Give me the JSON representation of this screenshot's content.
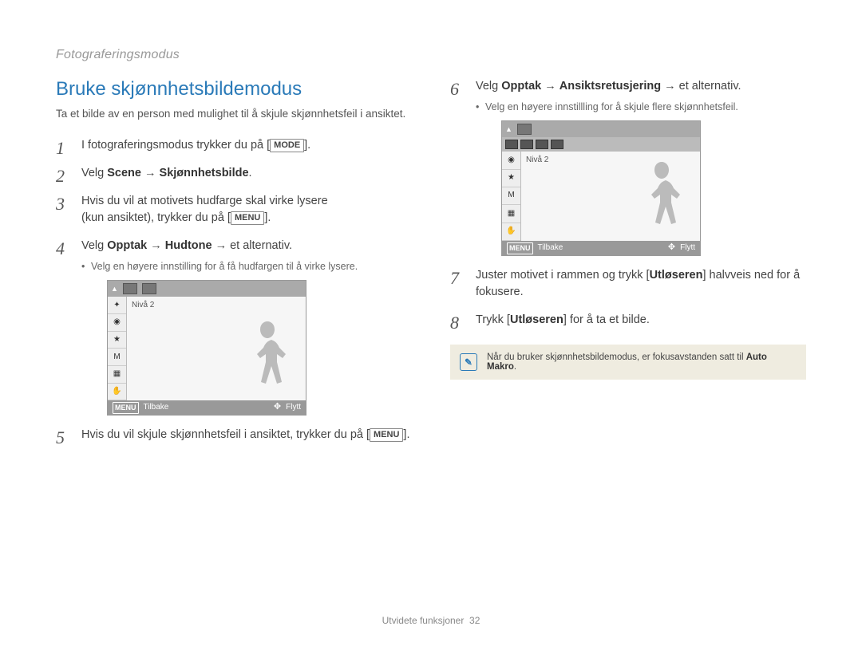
{
  "breadcrumb": "Fotograferingsmodus",
  "section_title": "Bruke skjønnhetsbildemodus",
  "intro": "Ta et bilde av en person med mulighet til å skjule skjønnhetsfeil i ansiktet.",
  "keys": {
    "mode": "MODE",
    "menu": "MENU"
  },
  "steps": {
    "s1": {
      "prefix": "I fotograferingsmodus trykker du på [",
      "suffix": "]."
    },
    "s2": {
      "prefix": "Velg ",
      "b1": "Scene",
      "arrow": " → ",
      "b2": "Skjønnhetsbilde",
      "suffix": "."
    },
    "s3": {
      "line1": "Hvis du vil at motivets hudfarge skal virke lysere",
      "line2_pre": "(kun ansiktet), trykker du på [",
      "line2_post": "]."
    },
    "s4": {
      "prefix": "Velg ",
      "b1": "Opptak",
      "arrow1": " → ",
      "b2": "Hudtone",
      "arrow2": " → et alternativ.",
      "sub": "Velg en høyere innstilling for å få hudfargen til å virke lysere."
    },
    "s5": {
      "pre": "Hvis du vil skjule skjønnhetsfeil i ansiktet, trykker du på [",
      "post": "]."
    },
    "s6": {
      "prefix": "Velg ",
      "b1": "Opptak",
      "arrow1": " → ",
      "b2": "Ansiktsretusjering",
      "arrow2": " → et alternativ.",
      "sub": "Velg en høyere innstillling for å skjule flere skjønnhetsfeil."
    },
    "s7": {
      "pre": "Juster motivet i rammen og trykk [",
      "b": "Utløseren",
      "post": "] halvveis ned for å fokusere."
    },
    "s8": {
      "pre": "Trykk [",
      "b": "Utløseren",
      "post": "] for å ta et bilde."
    }
  },
  "screen": {
    "level": "Nivå 2",
    "back": "Tilbake",
    "move": "Flytt",
    "menu": "MENU",
    "icons": [
      "✦",
      "◉",
      "★",
      "M",
      "▦",
      "✋"
    ]
  },
  "note": {
    "text_pre": "Når du bruker skjønnhetsbildemodus, er fokusavstanden satt til ",
    "bold": "Auto Makro",
    "text_post": "."
  },
  "footer": {
    "label": "Utvidete funksjoner",
    "page": "32"
  }
}
